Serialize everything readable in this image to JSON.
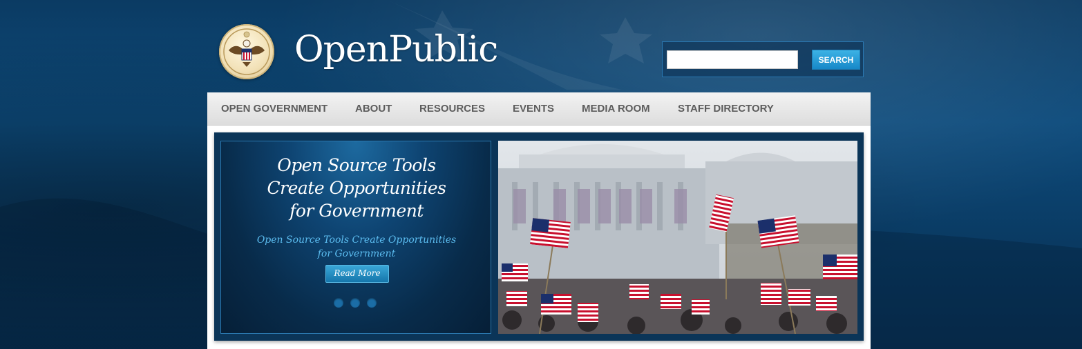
{
  "header": {
    "site_title": "OpenPublic",
    "logo_icon": "great-seal-icon"
  },
  "search": {
    "value": "",
    "placeholder": "",
    "button_label": "SEARCH"
  },
  "nav": {
    "items": [
      {
        "label": "OPEN GOVERNMENT"
      },
      {
        "label": "ABOUT"
      },
      {
        "label": "RESOURCES"
      },
      {
        "label": "EVENTS"
      },
      {
        "label": "MEDIA ROOM"
      },
      {
        "label": "STAFF DIRECTORY"
      }
    ]
  },
  "slider": {
    "heading_lines": [
      "Open Source Tools",
      "Create Opportunities",
      "for Government"
    ],
    "subtitle_lines": [
      "Open Source Tools Create Opportunities",
      "for Government"
    ],
    "read_more_label": "Read More",
    "dot_count": 3,
    "image_icon": "capitol-flags-photo"
  },
  "colors": {
    "background": "#0b3d66",
    "nav_text": "#5c5c5c",
    "accent": "#1788c8",
    "subtitle": "#5cbdf0"
  }
}
